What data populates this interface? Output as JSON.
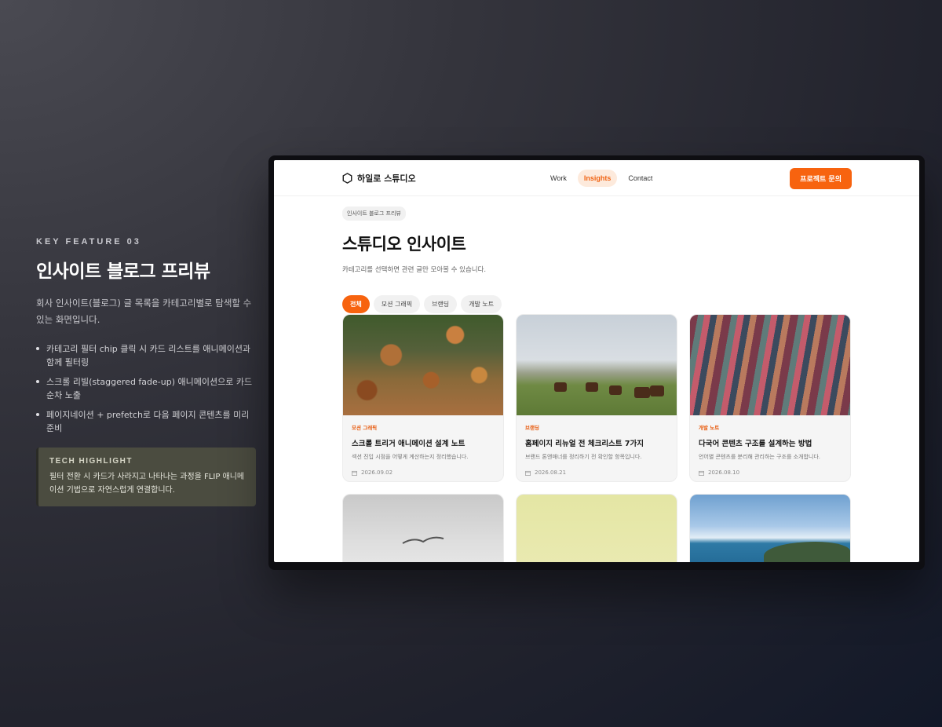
{
  "feature": {
    "eyebrow": "KEY FEATURE 03",
    "title": "인사이트 블로그 프리뷰",
    "description": "회사 인사이트(블로그) 글 목록을 카테고리별로 탐색할 수 있는 화면입니다.",
    "bullets": [
      "카테고리 필터 chip 클릭 시 카드 리스트를 애니메이션과 함께 필터링",
      "스크롤 리빌(staggered fade-up) 애니메이션으로 카드 순차 노출",
      "페이지네이션 + prefetch로 다음 페이지 콘텐츠를 미리 준비"
    ],
    "tech": {
      "label": "TECH HIGHLIGHT",
      "text": "필터 전환 시 카드가 사라지고 나타나는 과정을 FLIP 애니메이션 기법으로 자연스럽게 연결합니다."
    }
  },
  "site": {
    "brand": "하일로 스튜디오",
    "brand_icon": "hexagon-icon",
    "nav": [
      "Work",
      "Insights",
      "Contact"
    ],
    "cta": "프로젝트 문의",
    "accent": "#f7630f"
  },
  "page": {
    "breadcrumb": "인사이트 블로그 프리뷰",
    "title": "스튜디오 인사이트",
    "subtitle": "카테고리를 선택하면 관련 글만 모아볼 수 있습니다.",
    "filters": [
      "전체",
      "모션 그래픽",
      "브랜딩",
      "개발 노트"
    ],
    "active_filter": "전체"
  },
  "cards": [
    {
      "category": "모션 그래픽",
      "title": "스크롤 트리거 애니메이션 설계 노트",
      "excerpt": "섹션 진입 시점을 어떻게 계산하는지 정리했습니다.",
      "date": "2026.09.02",
      "image": "autumn-leaves"
    },
    {
      "category": "브랜딩",
      "title": "홈페이지 리뉴얼 전 체크리스트 7가지",
      "excerpt": "브랜드 톤앤매너를 정리하기 전 확인할 항목입니다.",
      "date": "2026.08.21",
      "image": "horses-field"
    },
    {
      "category": "개발 노트",
      "title": "다국어 콘텐츠 구조를 설계하는 방법",
      "excerpt": "언어별 콘텐츠를 분리해 관리하는 구조를 소개합니다.",
      "date": "2026.08.10",
      "image": "woven-textile"
    }
  ],
  "partial_cards": [
    {
      "image": "seagull-sky"
    },
    {
      "image": "lime-gradient"
    },
    {
      "image": "coastline"
    }
  ]
}
